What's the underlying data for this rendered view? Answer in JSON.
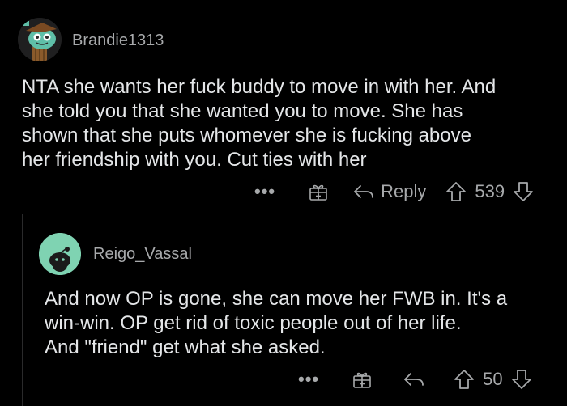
{
  "comments": [
    {
      "username": "Brandie1313",
      "avatar_icon": "snoo-avatar-icon",
      "text_lines": [
        "NTA she wants her fuck buddy to move in with her. And",
        "she told you that she wanted you to move. She has",
        "shown that she puts whomever she is fucking above",
        "her friendship with you. Cut ties with her"
      ],
      "actions": {
        "more": "•••",
        "award_icon": "gift-icon",
        "reply_label": "Reply",
        "votes": "539"
      }
    },
    {
      "username": "Reigo_Vassal",
      "avatar_icon": "default-snoo-avatar-icon",
      "text_lines": [
        "And now OP is gone, she can move her FWB in. It's a",
        "win-win. OP get rid of toxic people out of her life.",
        "And \"friend\" get what she asked."
      ],
      "actions": {
        "more": "•••",
        "award_icon": "gift-icon",
        "votes": "50"
      }
    }
  ],
  "colors": {
    "background": "#000000",
    "text": "#e4e6e8",
    "muted": "#a7a9ab",
    "avatar2_bg": "#7fd3b2"
  }
}
